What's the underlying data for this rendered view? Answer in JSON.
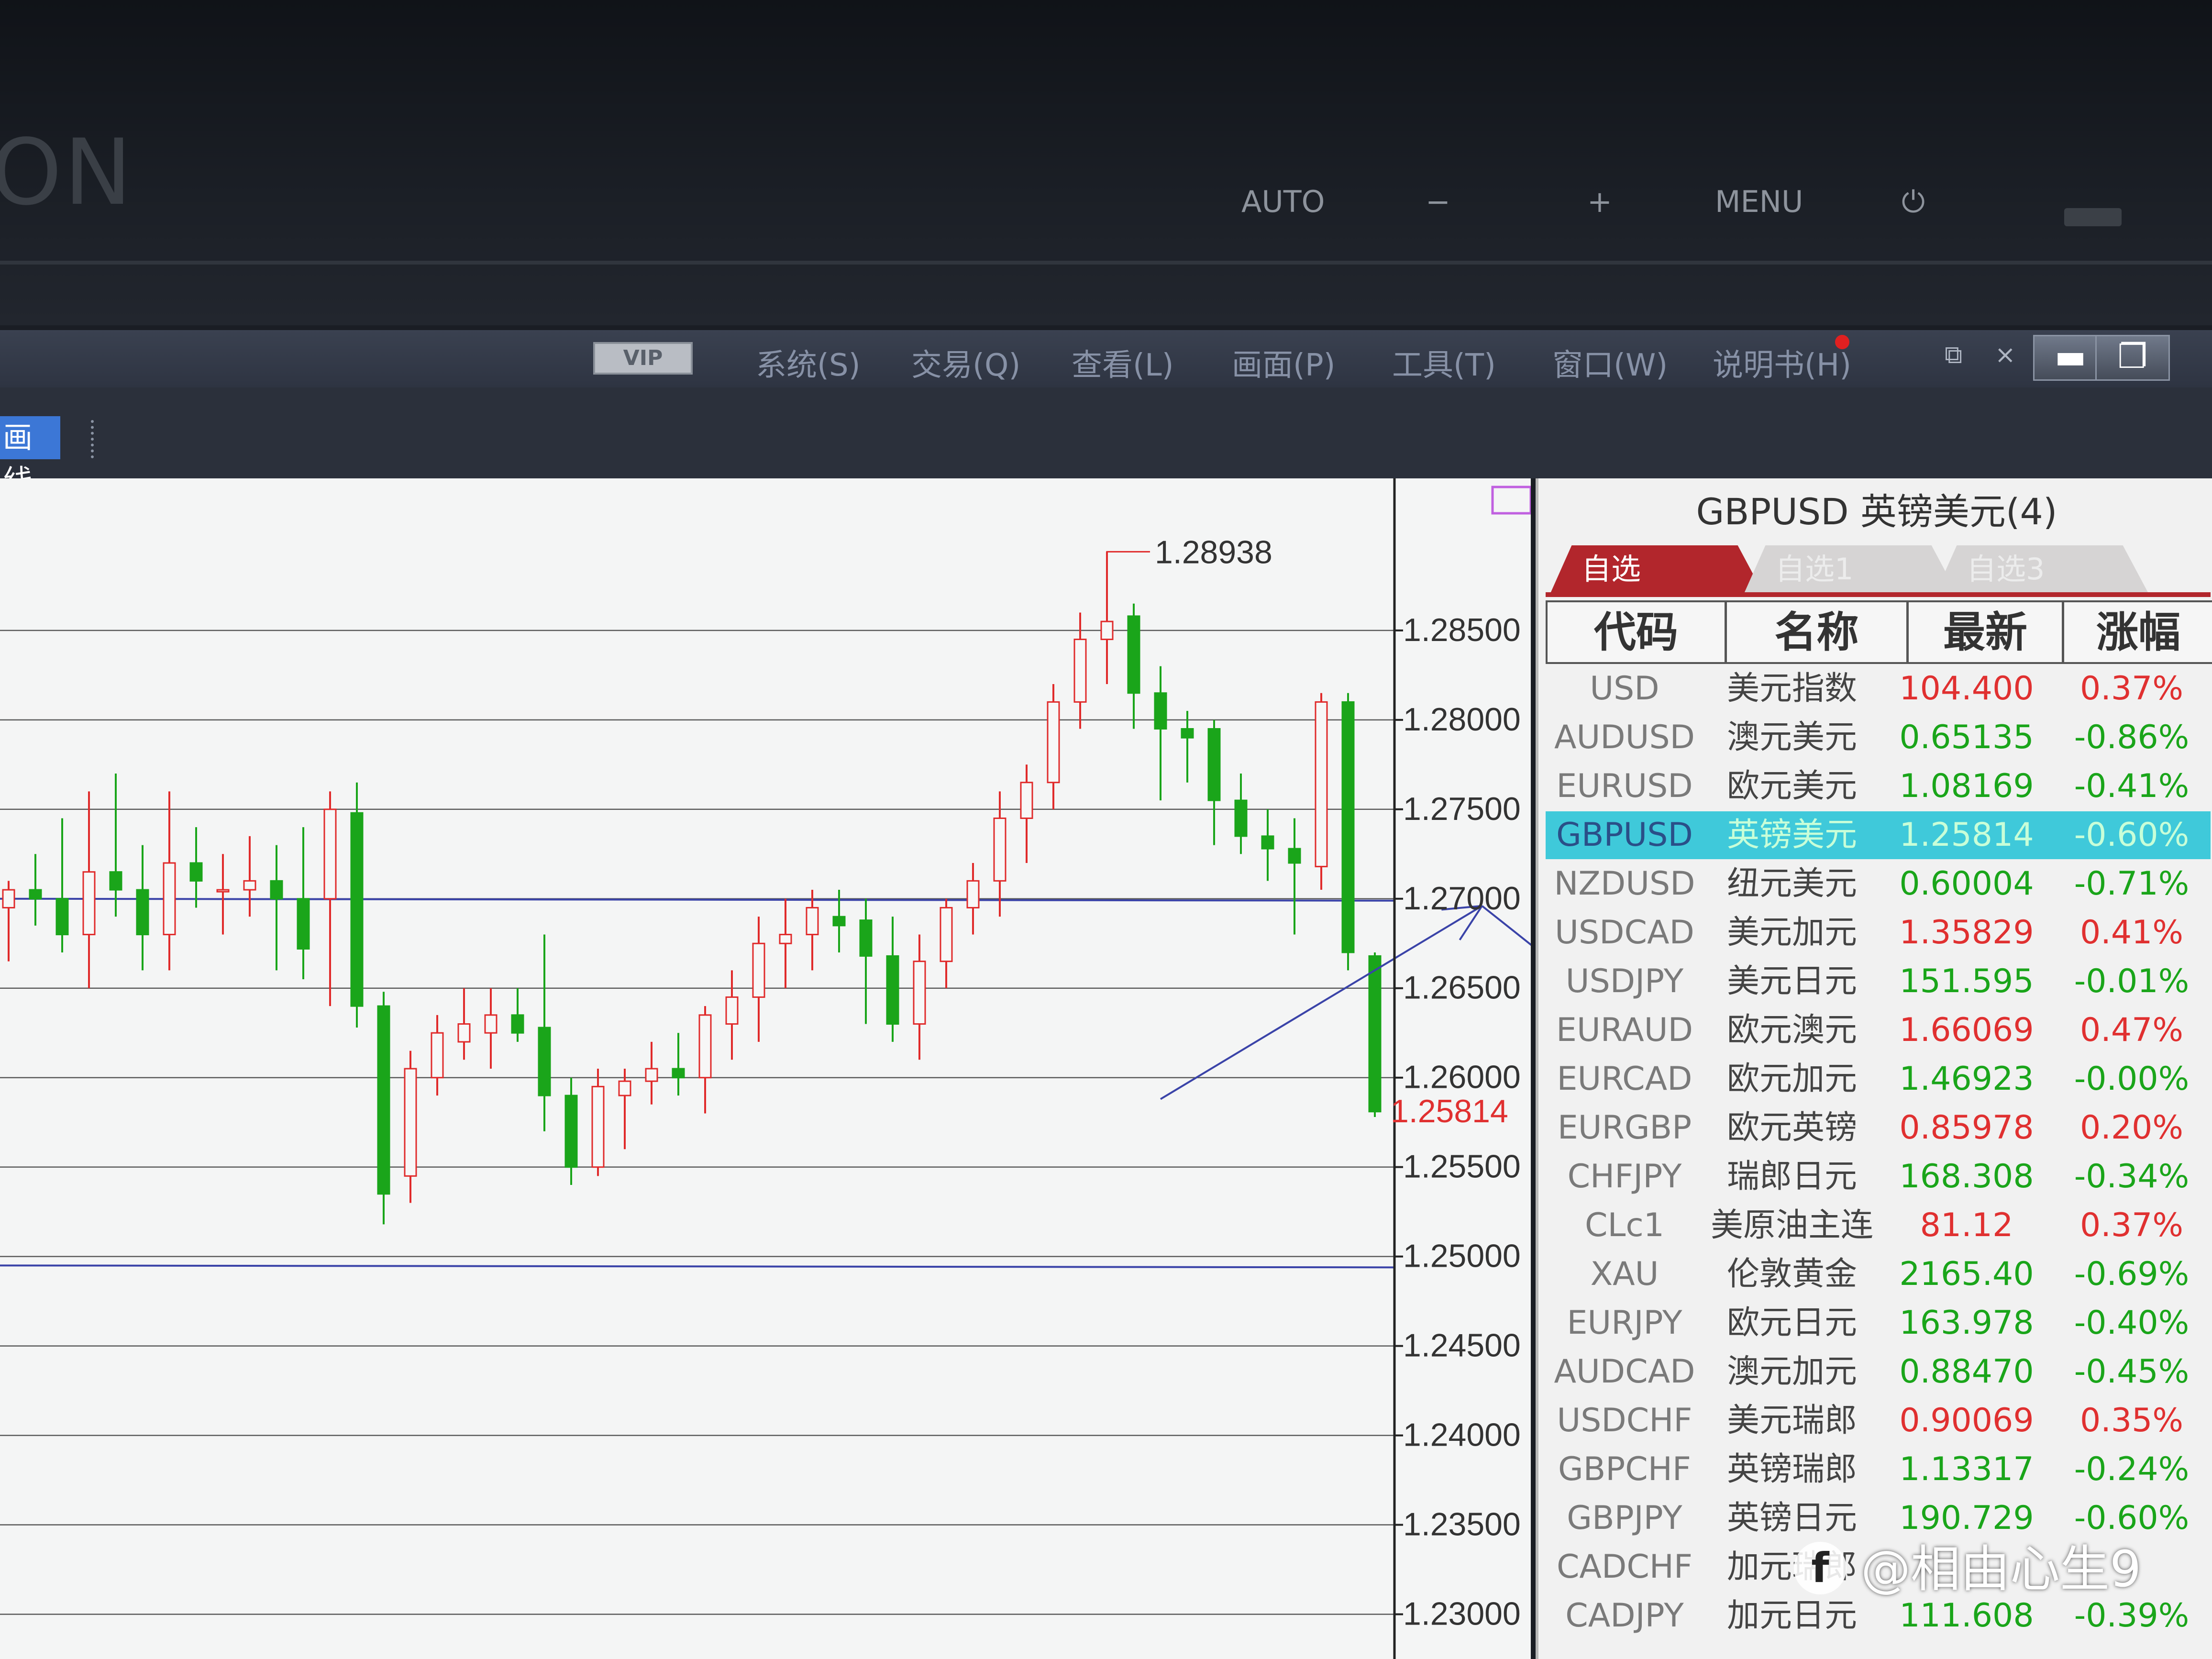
{
  "monitor": {
    "logo": "ON",
    "buttons": [
      "AUTO",
      "−",
      "+",
      "MENU",
      "⏻"
    ]
  },
  "menubar": {
    "vip_label": "VIP",
    "items": [
      "系统(S)",
      "交易(Q)",
      "查看(L)",
      "画面(P)",
      "工具(T)",
      "窗口(W)",
      "说明书(H)"
    ],
    "mdi_restore": "⧉",
    "mdi_close": "×",
    "minimize": "▬",
    "maximize": "❐"
  },
  "toolbar": {
    "draw_line_label": "画线"
  },
  "colors": {
    "up": "#e02b2b",
    "down": "#1aa51a",
    "grid": "#5a5a5a",
    "drawing": "#3a43a8",
    "price_marker": "#e03030",
    "highlight_row": "#3fc9da",
    "tab_active": "#b2262c"
  },
  "chart_data": {
    "type": "candlestick",
    "symbol": "GBPUSD",
    "ylim": [
      1.2275,
      1.2935
    ],
    "y_ticks": [
      "1.28500",
      "1.28000",
      "1.27500",
      "1.27000",
      "1.26500",
      "1.26000",
      "1.25500",
      "1.25000",
      "1.24500",
      "1.24000",
      "1.23500",
      "1.23000"
    ],
    "last_price_label": "1.25814",
    "high_annotation": "1.28938",
    "horizontal_lines": [
      1.27,
      1.2495
    ],
    "arrow_path": [
      [
        43,
        1.2588
      ],
      [
        55,
        1.2696
      ],
      [
        72,
        1.2494
      ]
    ],
    "candles": [
      {
        "o": 1.2695,
        "h": 1.271,
        "l": 1.2665,
        "c": 1.2705
      },
      {
        "o": 1.2705,
        "h": 1.2725,
        "l": 1.2685,
        "c": 1.27
      },
      {
        "o": 1.27,
        "h": 1.2745,
        "l": 1.267,
        "c": 1.268
      },
      {
        "o": 1.268,
        "h": 1.276,
        "l": 1.265,
        "c": 1.2715
      },
      {
        "o": 1.2715,
        "h": 1.277,
        "l": 1.269,
        "c": 1.2705
      },
      {
        "o": 1.2705,
        "h": 1.273,
        "l": 1.266,
        "c": 1.268
      },
      {
        "o": 1.268,
        "h": 1.276,
        "l": 1.266,
        "c": 1.272
      },
      {
        "o": 1.272,
        "h": 1.274,
        "l": 1.2695,
        "c": 1.271
      },
      {
        "o": 1.2705,
        "h": 1.2725,
        "l": 1.268,
        "c": 1.2705
      },
      {
        "o": 1.2705,
        "h": 1.2735,
        "l": 1.269,
        "c": 1.271
      },
      {
        "o": 1.271,
        "h": 1.273,
        "l": 1.266,
        "c": 1.27
      },
      {
        "o": 1.27,
        "h": 1.274,
        "l": 1.2655,
        "c": 1.2672
      },
      {
        "o": 1.27,
        "h": 1.276,
        "l": 1.264,
        "c": 1.275
      },
      {
        "o": 1.2748,
        "h": 1.2765,
        "l": 1.2628,
        "c": 1.264
      },
      {
        "o": 1.264,
        "h": 1.2648,
        "l": 1.2518,
        "c": 1.2535
      },
      {
        "o": 1.2545,
        "h": 1.2615,
        "l": 1.253,
        "c": 1.2605
      },
      {
        "o": 1.26,
        "h": 1.2635,
        "l": 1.259,
        "c": 1.2625
      },
      {
        "o": 1.262,
        "h": 1.265,
        "l": 1.261,
        "c": 1.263
      },
      {
        "o": 1.2625,
        "h": 1.265,
        "l": 1.2605,
        "c": 1.2635
      },
      {
        "o": 1.2635,
        "h": 1.265,
        "l": 1.262,
        "c": 1.2625
      },
      {
        "o": 1.2628,
        "h": 1.268,
        "l": 1.257,
        "c": 1.259
      },
      {
        "o": 1.259,
        "h": 1.26,
        "l": 1.254,
        "c": 1.255
      },
      {
        "o": 1.255,
        "h": 1.2605,
        "l": 1.2545,
        "c": 1.2595
      },
      {
        "o": 1.259,
        "h": 1.2605,
        "l": 1.256,
        "c": 1.2598
      },
      {
        "o": 1.2598,
        "h": 1.262,
        "l": 1.2585,
        "c": 1.2605
      },
      {
        "o": 1.2605,
        "h": 1.2625,
        "l": 1.259,
        "c": 1.26
      },
      {
        "o": 1.26,
        "h": 1.264,
        "l": 1.258,
        "c": 1.2635
      },
      {
        "o": 1.263,
        "h": 1.266,
        "l": 1.261,
        "c": 1.2645
      },
      {
        "o": 1.2645,
        "h": 1.269,
        "l": 1.262,
        "c": 1.2675
      },
      {
        "o": 1.2675,
        "h": 1.27,
        "l": 1.265,
        "c": 1.268
      },
      {
        "o": 1.268,
        "h": 1.2705,
        "l": 1.266,
        "c": 1.2695
      },
      {
        "o": 1.269,
        "h": 1.2705,
        "l": 1.267,
        "c": 1.2685
      },
      {
        "o": 1.2688,
        "h": 1.27,
        "l": 1.263,
        "c": 1.2668
      },
      {
        "o": 1.2668,
        "h": 1.269,
        "l": 1.262,
        "c": 1.263
      },
      {
        "o": 1.263,
        "h": 1.268,
        "l": 1.261,
        "c": 1.2665
      },
      {
        "o": 1.2665,
        "h": 1.27,
        "l": 1.265,
        "c": 1.2695
      },
      {
        "o": 1.2695,
        "h": 1.272,
        "l": 1.268,
        "c": 1.271
      },
      {
        "o": 1.271,
        "h": 1.276,
        "l": 1.269,
        "c": 1.2745
      },
      {
        "o": 1.2745,
        "h": 1.2775,
        "l": 1.272,
        "c": 1.2765
      },
      {
        "o": 1.2765,
        "h": 1.282,
        "l": 1.275,
        "c": 1.281
      },
      {
        "o": 1.281,
        "h": 1.286,
        "l": 1.2795,
        "c": 1.2845
      },
      {
        "o": 1.2845,
        "h": 1.2894,
        "l": 1.282,
        "c": 1.2855
      },
      {
        "o": 1.2858,
        "h": 1.2865,
        "l": 1.2795,
        "c": 1.2815
      },
      {
        "o": 1.2815,
        "h": 1.283,
        "l": 1.2755,
        "c": 1.2795
      },
      {
        "o": 1.2795,
        "h": 1.2805,
        "l": 1.2765,
        "c": 1.279
      },
      {
        "o": 1.2795,
        "h": 1.28,
        "l": 1.273,
        "c": 1.2755
      },
      {
        "o": 1.2755,
        "h": 1.277,
        "l": 1.2725,
        "c": 1.2735
      },
      {
        "o": 1.2735,
        "h": 1.275,
        "l": 1.271,
        "c": 1.2728
      },
      {
        "o": 1.2728,
        "h": 1.2745,
        "l": 1.268,
        "c": 1.272
      },
      {
        "o": 1.2718,
        "h": 1.2815,
        "l": 1.2705,
        "c": 1.281
      },
      {
        "o": 1.281,
        "h": 1.2815,
        "l": 1.266,
        "c": 1.267
      },
      {
        "o": 1.2668,
        "h": 1.267,
        "l": 1.2578,
        "c": 1.2581
      }
    ]
  },
  "panel": {
    "title": "GBPUSD 英镑美元(4)",
    "tabs": [
      "自选",
      "自选1",
      "自选3"
    ],
    "headers": [
      "代码",
      "名称",
      "最新",
      "涨幅"
    ],
    "rows": [
      {
        "code": "USD",
        "name": "美元指数",
        "last": "104.400",
        "chg": "0.37%",
        "up": true
      },
      {
        "code": "AUDUSD",
        "name": "澳元美元",
        "last": "0.65135",
        "chg": "-0.86%",
        "up": false
      },
      {
        "code": "EURUSD",
        "name": "欧元美元",
        "last": "1.08169",
        "chg": "-0.41%",
        "up": false
      },
      {
        "code": "GBPUSD",
        "name": "英镑美元",
        "last": "1.25814",
        "chg": "-0.60%",
        "up": false
      },
      {
        "code": "NZDUSD",
        "name": "纽元美元",
        "last": "0.60004",
        "chg": "-0.71%",
        "up": false
      },
      {
        "code": "USDCAD",
        "name": "美元加元",
        "last": "1.35829",
        "chg": "0.41%",
        "up": true
      },
      {
        "code": "USDJPY",
        "name": "美元日元",
        "last": "151.595",
        "chg": "-0.01%",
        "up": false
      },
      {
        "code": "EURAUD",
        "name": "欧元澳元",
        "last": "1.66069",
        "chg": "0.47%",
        "up": true
      },
      {
        "code": "EURCAD",
        "name": "欧元加元",
        "last": "1.46923",
        "chg": "-0.00%",
        "up": false
      },
      {
        "code": "EURGBP",
        "name": "欧元英镑",
        "last": "0.85978",
        "chg": "0.20%",
        "up": true
      },
      {
        "code": "CHFJPY",
        "name": "瑞郎日元",
        "last": "168.308",
        "chg": "-0.34%",
        "up": false
      },
      {
        "code": "CLc1",
        "name": "美原油主连",
        "last": "81.12",
        "chg": "0.37%",
        "up": true
      },
      {
        "code": "XAU",
        "name": "伦敦黄金",
        "last": "2165.40",
        "chg": "-0.69%",
        "up": false
      },
      {
        "code": "EURJPY",
        "name": "欧元日元",
        "last": "163.978",
        "chg": "-0.40%",
        "up": false
      },
      {
        "code": "AUDCAD",
        "name": "澳元加元",
        "last": "0.88470",
        "chg": "-0.45%",
        "up": false
      },
      {
        "code": "USDCHF",
        "name": "美元瑞郎",
        "last": "0.90069",
        "chg": "0.35%",
        "up": true
      },
      {
        "code": "GBPCHF",
        "name": "英镑瑞郎",
        "last": "1.13317",
        "chg": "-0.24%",
        "up": false
      },
      {
        "code": "GBPJPY",
        "name": "英镑日元",
        "last": "190.729",
        "chg": "-0.60%",
        "up": false
      },
      {
        "code": "CADCHF",
        "name": "加元瑞郎",
        "last": "",
        "chg": "",
        "up": true
      },
      {
        "code": "CADJPY",
        "name": "加元日元",
        "last": "111.608",
        "chg": "-0.39%",
        "up": false
      }
    ]
  },
  "watermark": {
    "text": "@相由心生9",
    "logo": "f"
  }
}
